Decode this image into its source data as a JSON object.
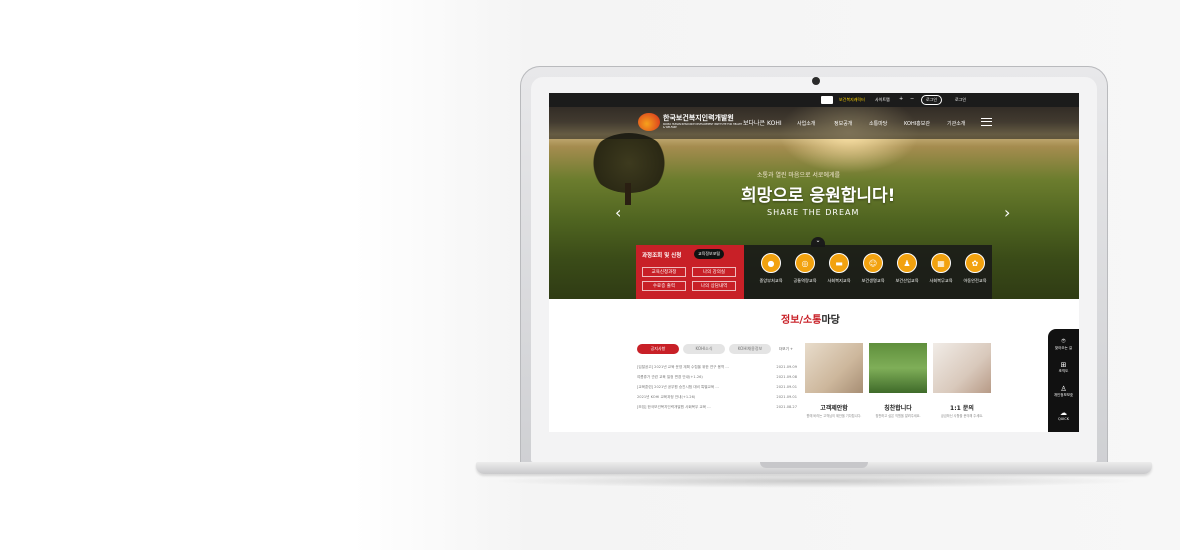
{
  "site": {
    "brand_name": "한국보건복지인력개발원",
    "brand_sub": "KOREA HUMAN RESOURCE DEVELOPMENT INSTITUTE FOR HEALTH & WELFARE",
    "slogan_logo": "보다나은 KOHI",
    "top_links": [
      "보건복지캐릭터",
      "사이트맵",
      "+",
      "−",
      "로그인"
    ],
    "top_btn": "로그인",
    "top_pill": "로그인",
    "nav": [
      "사업소개",
      "정보공개",
      "소통마당",
      "KOHI홍보관",
      "기관소개"
    ]
  },
  "hero": {
    "sub": "소통과 열린 마음으로 서로에게를",
    "title": "희망으로 응원합니다!",
    "eng": "SHARE THE DREAM"
  },
  "course_box": {
    "title": "과정조회 및 신청",
    "pill": "교육정보포털",
    "buttons": [
      "교육신청과정",
      "나의 강의실",
      "수료증 출력",
      "나의 상담내역"
    ]
  },
  "categories": [
    {
      "label": "중앙부처교육",
      "icon": "people-icon"
    },
    {
      "label": "공통역량교육",
      "icon": "target-icon"
    },
    {
      "label": "사회복지교육",
      "icon": "card-icon"
    },
    {
      "label": "보건생명교육",
      "icon": "face-icon"
    },
    {
      "label": "보건산업교육",
      "icon": "group-icon"
    },
    {
      "label": "사회복무교육",
      "icon": "calendar-icon"
    },
    {
      "label": "아동안전교육",
      "icon": "child-icon"
    }
  ],
  "section": {
    "title_red": "정보/소통",
    "title_black": "마당"
  },
  "tabs": [
    "공지사항",
    "KOHI소식",
    "KOHI채용정보"
  ],
  "more": "더보기 +",
  "news": [
    {
      "title": "[입찰공고] 2021년 교육 운영 계획 수립을 위한 연구 용역 ...",
      "date": "2021.09.09"
    },
    {
      "title": "여름휴가 관련 교육 일정 변경 안내(+1.26)",
      "date": "2021.09.08"
    },
    {
      "title": "[교육훈련] 2021년 공무원 승진시험 대비 특별교육 ...",
      "date": "2021.09.01"
    },
    {
      "title": "2021년 KOHI 교육과정 안내(+1.26)",
      "date": "2021.09.01"
    },
    {
      "title": "[모집] 한국보건복지인력개발원 사회복무 교육 ...",
      "date": "2021.08.27"
    }
  ],
  "cards": [
    {
      "title": "고객제안함",
      "sub": "원에 바라는 고객님의 제안을 기다립니다."
    },
    {
      "title": "칭찬합니다",
      "sub": "칭찬하고 싶은 직원을 알려주세요."
    },
    {
      "title": "1:1 문의",
      "sub": "궁금하신 사항을 문의해 주세요."
    }
  ],
  "quick_menu": [
    "찾아오는 길",
    "조직도",
    "개인정보보호",
    "QUICK"
  ],
  "colors": {
    "accent": "#c82027",
    "circle": "#f2a20f"
  }
}
